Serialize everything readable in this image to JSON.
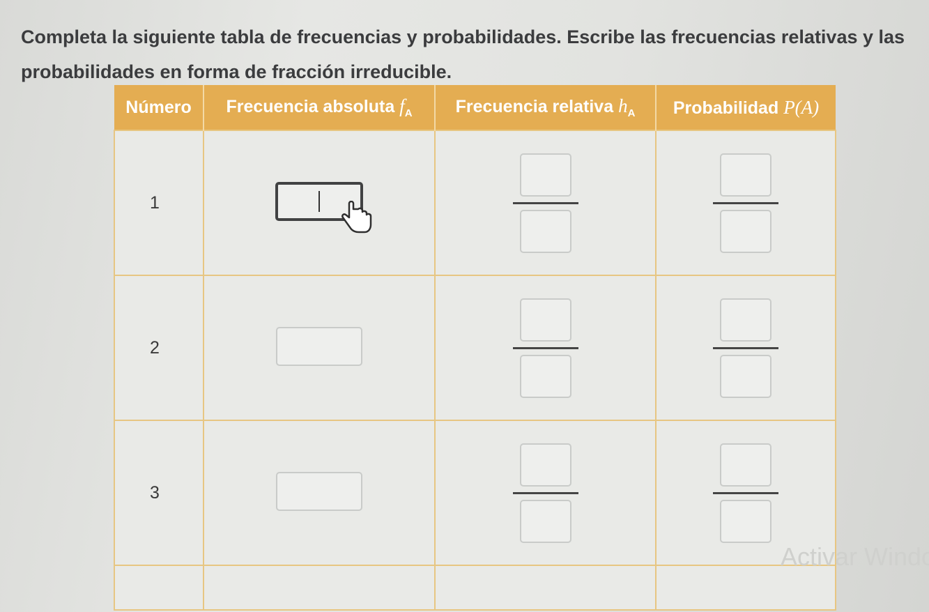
{
  "instructions": "Completa la siguiente tabla de frecuencias y probabilidades. Escribe las frecuencias relativas y las probabilidades en forma de fracción irreducible.",
  "table": {
    "headers": {
      "numero": "Número",
      "frecuencia_absoluta": "Frecuencia absoluta",
      "frecuencia_absoluta_symbol": "f",
      "frecuencia_relativa": "Frecuencia relativa",
      "frecuencia_relativa_symbol": "h",
      "probabilidad": "Probabilidad",
      "probabilidad_symbol": "P(A)",
      "subscript": "A"
    },
    "rows": [
      {
        "numero": "1",
        "frecuencia_absoluta": "",
        "relativa_num": "",
        "relativa_den": "",
        "prob_num": "",
        "prob_den": ""
      },
      {
        "numero": "2",
        "frecuencia_absoluta": "",
        "relativa_num": "",
        "relativa_den": "",
        "prob_num": "",
        "prob_den": ""
      },
      {
        "numero": "3",
        "frecuencia_absoluta": "",
        "relativa_num": "",
        "relativa_den": "",
        "prob_num": "",
        "prob_den": ""
      }
    ]
  },
  "watermark": "Activar Windo",
  "colors": {
    "header_bg": "#e4ad52",
    "border": "#e7c682",
    "text": "#3a3a3a"
  },
  "icons": {
    "cursor": "hand-pointer-icon"
  }
}
